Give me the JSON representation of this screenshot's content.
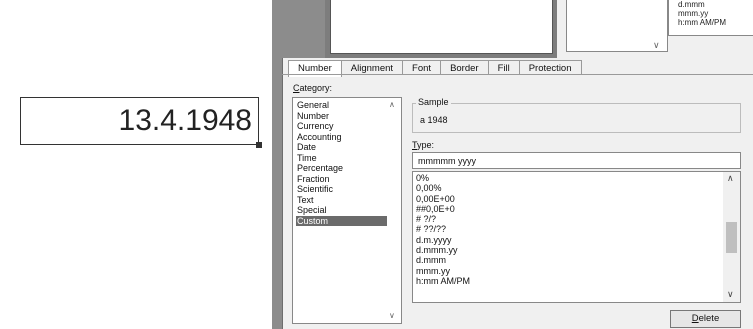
{
  "sheet": {
    "cell_value": "13.4.1948"
  },
  "background_window": {
    "list_items": [
      "d.mmm",
      "mmm.yy",
      "h:mm AM/PM"
    ]
  },
  "tabs": [
    {
      "label": "Number",
      "active": true
    },
    {
      "label": "Alignment",
      "active": false
    },
    {
      "label": "Font",
      "active": false
    },
    {
      "label": "Border",
      "active": false
    },
    {
      "label": "Fill",
      "active": false
    },
    {
      "label": "Protection",
      "active": false
    }
  ],
  "category": {
    "label_first": "C",
    "label_rest": "ategory:",
    "items": [
      "General",
      "Number",
      "Currency",
      "Accounting",
      "Date",
      "Time",
      "Percentage",
      "Fraction",
      "Scientific",
      "Text",
      "Special",
      "Custom"
    ],
    "selected": "Custom"
  },
  "sample": {
    "title": "Sample",
    "value": "a 1948"
  },
  "type": {
    "label_first": "T",
    "label_rest": "ype:",
    "input_value": "mmmmm yyyy",
    "items": [
      "0%",
      "0,00%",
      "0,00E+00",
      "##0,0E+0",
      "# ?/?",
      "# ??/??",
      "d.m.yyyy",
      "d.mmm.yy",
      "d.mmm",
      "mmm.yy",
      "h:mm AM/PM"
    ]
  },
  "delete_button": {
    "label_first": "D",
    "label_rest": "elete"
  }
}
